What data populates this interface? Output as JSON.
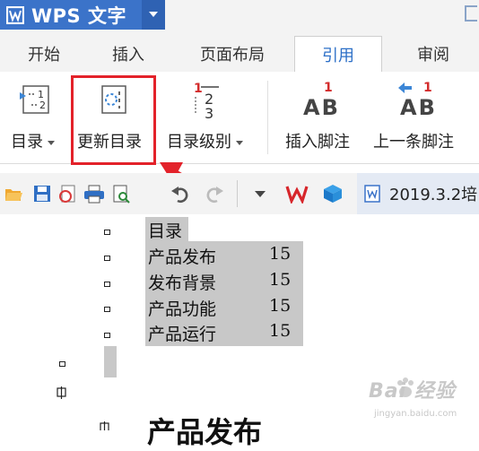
{
  "app": {
    "name": "WPS 文字"
  },
  "tabs": [
    "开始",
    "插入",
    "页面布局",
    "引用",
    "审阅"
  ],
  "active_tab": "引用",
  "ribbon": {
    "toc_label": "目录",
    "update_toc_label": "更新目录",
    "toc_level_label": "目录级别",
    "insert_footnote_label": "插入脚注",
    "prev_footnote_label": "上一条脚注",
    "ab_text": "AB",
    "footnote_mark": "1",
    "toc_level_icon": {
      "one": "1",
      "two": "2",
      "three": "3"
    },
    "toc_icon": {
      "one": "1",
      "two": "2"
    }
  },
  "document_tab": {
    "title": "2019.3.2培"
  },
  "document": {
    "toc_title": "目录",
    "toc_entries": [
      {
        "title": "产品发布",
        "page": "15"
      },
      {
        "title": "发布背景",
        "page": "15"
      },
      {
        "title": "产品功能",
        "page": "15"
      },
      {
        "title": "产品运行",
        "page": "15"
      }
    ],
    "heading": "产品发布"
  },
  "watermark": {
    "main": "Bai 经验",
    "sub": "jingyan.baidu.com"
  },
  "colors": {
    "accent": "#2c6fc7",
    "app_blue": "#3b73c9",
    "highlight": "#e3222a",
    "toc_shade": "#c8c8c8"
  }
}
